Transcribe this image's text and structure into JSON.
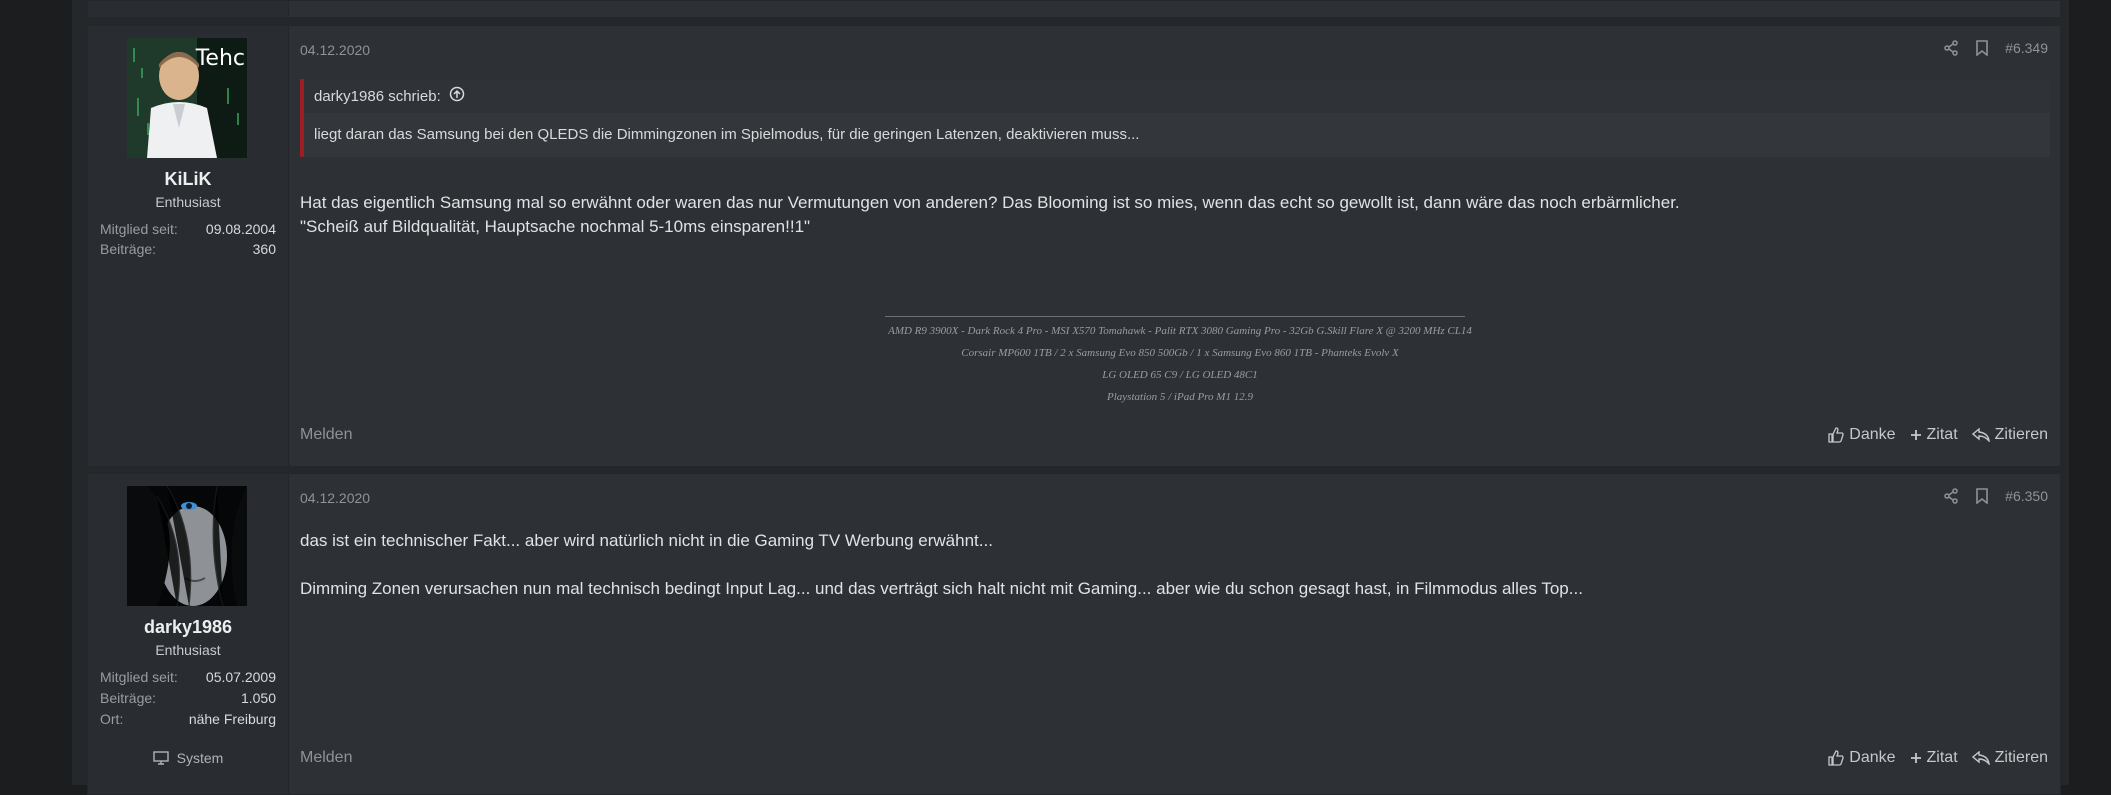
{
  "posts": [
    {
      "username": "KiLiK",
      "avatar_text": "Tehc",
      "user_title": "Enthusiast",
      "stats": [
        {
          "label": "Mitglied seit:",
          "value": "09.08.2004"
        },
        {
          "label": "Beiträge:",
          "value": "360"
        }
      ],
      "date": "04.12.2020",
      "post_number": "#6.349",
      "quote": {
        "author": "darky1986 schrieb:",
        "text": "liegt daran das Samsung bei den QLEDS die Dimmingzonen im Spielmodus, für die geringen Latenzen, deaktivieren muss..."
      },
      "message_lines": [
        "Hat das eigentlich Samsung mal so erwähnt oder waren das nur Vermutungen von anderen? Das Blooming ist so mies, wenn das echt so gewollt ist, dann wäre das noch erbärmlicher.",
        "\"Scheiß auf Bildqualität, Hauptsache nochmal 5-10ms einsparen!!1\""
      ],
      "signature": [
        "AMD R9 3900X - Dark Rock 4 Pro - MSI X570 Tomahawk - Palit RTX 3080 Gaming Pro - 32Gb G.Skill Flare X @ 3200 MHz CL14",
        "Corsair MP600 1TB / 2 x Samsung Evo 850 500Gb / 1 x Samsung Evo 860 1TB - Phanteks Evolv X",
        "LG OLED 65 C9 / LG OLED 48C1",
        "Playstation 5 / iPad Pro M1 12.9"
      ],
      "report_label": "Melden",
      "actions": {
        "thanks": "Danke",
        "quote_add": "Zitat",
        "reply_quote": "Zitieren"
      }
    },
    {
      "username": "darky1986",
      "user_title": "Enthusiast",
      "stats": [
        {
          "label": "Mitglied seit:",
          "value": "05.07.2009"
        },
        {
          "label": "Beiträge:",
          "value": "1.050"
        },
        {
          "label": "Ort:",
          "value": "nähe Freiburg"
        }
      ],
      "system_label": "System",
      "date": "04.12.2020",
      "post_number": "#6.350",
      "message_lines": [
        "das ist ein technischer Fakt... aber wird natürlich nicht in die Gaming TV Werbung erwähnt...",
        "",
        "Dimming Zonen verursachen nun mal technisch bedingt Input Lag... und das verträgt sich halt nicht mit Gaming... aber wie du schon gesagt hast, in Filmmodus alles Top..."
      ],
      "report_label": "Melden",
      "actions": {
        "thanks": "Danke",
        "quote_add": "Zitat",
        "reply_quote": "Zitieren"
      }
    }
  ],
  "colors": {
    "quote_border": "#9c1d24",
    "post_bg": "#2d3034",
    "user_col_bg": "#292c30"
  }
}
